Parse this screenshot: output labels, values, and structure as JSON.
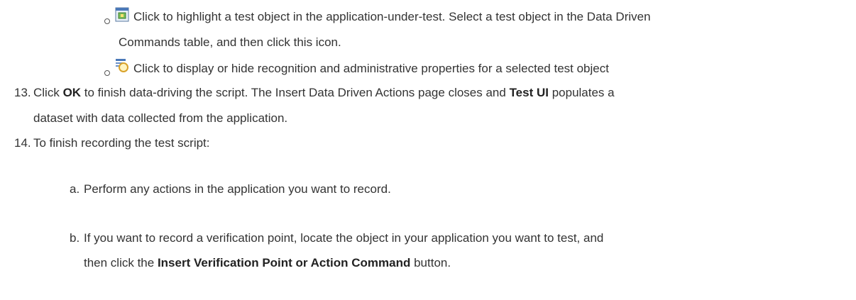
{
  "bullets": [
    {
      "icon": "highlight-test-object-icon",
      "line1": "Click to highlight a test object in the application-under-test. Select a test object in the Data Driven",
      "line2": "Commands table, and then click this icon."
    },
    {
      "icon": "display-properties-icon",
      "line1": "Click to display or hide recognition and administrative properties for a selected test object"
    }
  ],
  "step13": {
    "number": "13.",
    "pre": "Click ",
    "ok": "OK",
    "mid": " to finish data-driving the script. The Insert Data Driven Actions page closes and ",
    "testui": "Test UI",
    "post": " populates a",
    "line2": "dataset with data collected from the application."
  },
  "step14": {
    "number": "14.",
    "text": "To finish recording the test script:",
    "substeps": [
      {
        "marker": "a.",
        "text": "Perform any actions in the application you want to record."
      },
      {
        "marker": "b.",
        "line1": "If you want to record a verification point, locate the object in your application you want to test, and",
        "line2_pre": "then click the ",
        "line2_bold": "Insert Verification Point or Action Command",
        "line2_post": " button."
      }
    ]
  }
}
